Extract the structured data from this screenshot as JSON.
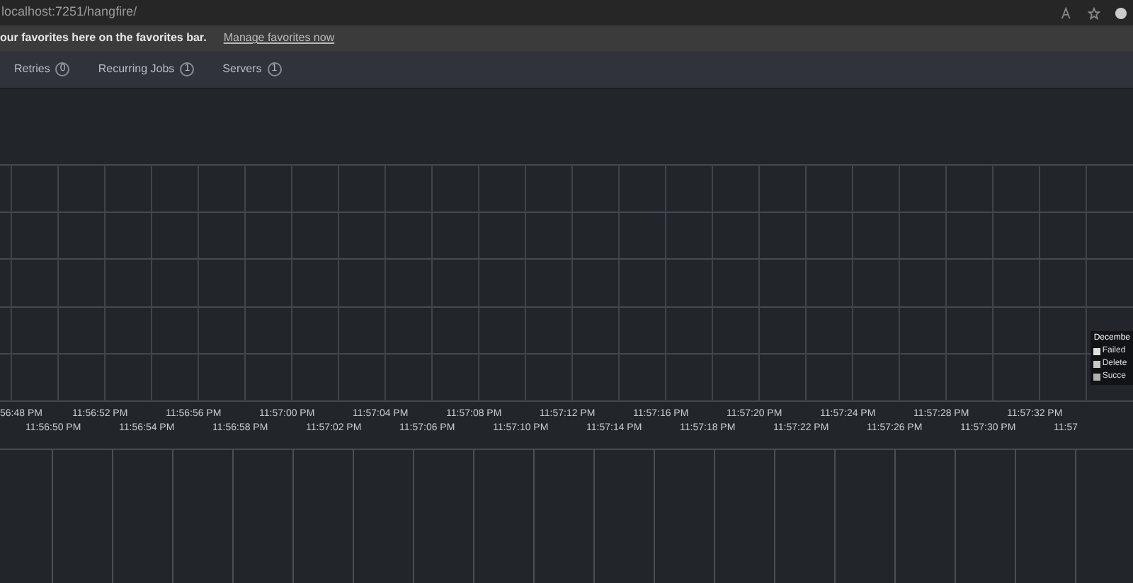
{
  "browser": {
    "address": "localhost:7251/hangfire/",
    "favorites_message": "our favorites here on the favorites bar.",
    "favorites_link": "Manage favorites now"
  },
  "nav": [
    {
      "label": "Retries",
      "count": "0"
    },
    {
      "label": "Recurring Jobs",
      "count": "1"
    },
    {
      "label": "Servers",
      "count": "1"
    }
  ],
  "realtime_graph": {
    "x_labels": [
      "56:48 PM",
      "11:56:50 PM",
      "11:56:52 PM",
      "11:56:54 PM",
      "11:56:56 PM",
      "11:56:58 PM",
      "11:57:00 PM",
      "11:57:02 PM",
      "11:57:04 PM",
      "11:57:06 PM",
      "11:57:08 PM",
      "11:57:10 PM",
      "11:57:12 PM",
      "11:57:14 PM",
      "11:57:16 PM",
      "11:57:18 PM",
      "11:57:20 PM",
      "11:57:22 PM",
      "11:57:24 PM",
      "11:57:26 PM",
      "11:57:28 PM",
      "11:57:30 PM",
      "11:57:32 PM",
      "11:57"
    ],
    "legend": {
      "title": "Decembe",
      "items": [
        {
          "label": "Failed",
          "color": "#e0e0e0"
        },
        {
          "label": "Delete",
          "color": "#c8c8c8"
        },
        {
          "label": "Succe",
          "color": "#b0b0b0"
        }
      ]
    }
  }
}
